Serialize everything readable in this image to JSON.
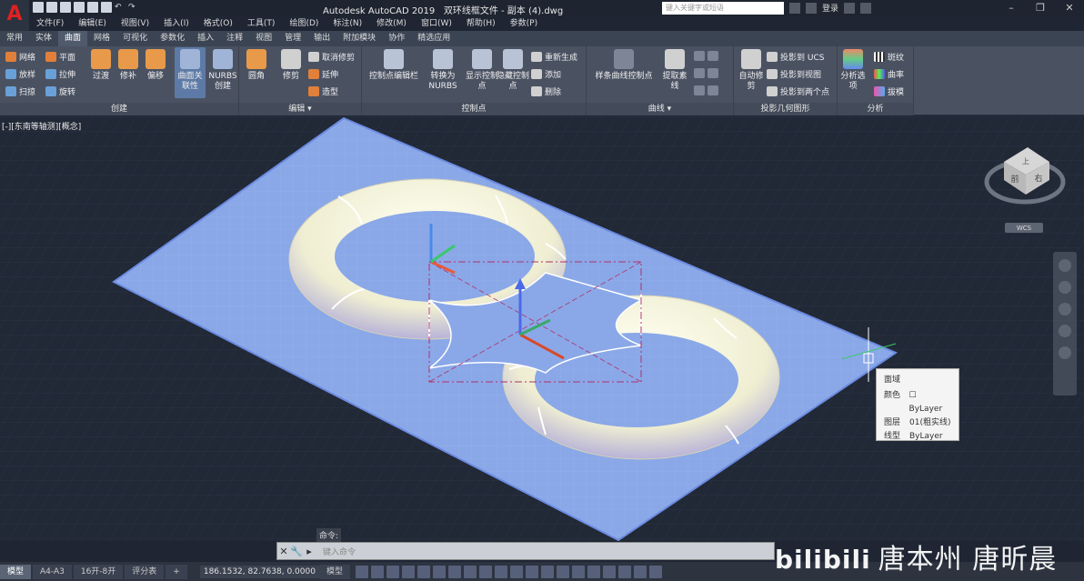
{
  "title": {
    "app": "Autodesk AutoCAD 2019",
    "file": "双环线框文件 - 副本 (4).dwg",
    "search_placeholder": "键入关键字或短语",
    "login": "登录"
  },
  "menu": [
    "文件(F)",
    "编辑(E)",
    "视图(V)",
    "插入(I)",
    "格式(O)",
    "工具(T)",
    "绘图(D)",
    "标注(N)",
    "修改(M)",
    "窗口(W)",
    "帮助(H)",
    "参数(P)"
  ],
  "tabs": [
    "常用",
    "实体",
    "曲面",
    "网格",
    "可视化",
    "参数化",
    "插入",
    "注释",
    "视图",
    "管理",
    "输出",
    "附加模块",
    "协作",
    "精选应用"
  ],
  "active_tab": "曲面",
  "ribbon": {
    "create": {
      "title": "创建",
      "small": [
        "网络",
        "放样",
        "扫掠",
        "平面",
        "拉伸",
        "旋转"
      ],
      "big": [
        "过渡",
        "修补",
        "偏移",
        "曲面关联性",
        "NURBS创建"
      ]
    },
    "edit": {
      "title": "编辑",
      "big": [
        "圆角",
        "修剪"
      ],
      "small": [
        "取消修剪",
        "延伸",
        "造型"
      ]
    },
    "cv": {
      "title": "控制点",
      "big": [
        "控制点编辑栏",
        "转换为NURBS",
        "显示控制点",
        "隐藏控制点"
      ],
      "small": [
        "重新生成",
        "添加",
        "删除"
      ]
    },
    "curves": {
      "title": "曲线",
      "big": [
        "样条曲线控制点",
        "提取素线"
      ]
    },
    "project": {
      "title": "投影几何图形",
      "big": [
        "自动修剪"
      ],
      "small": [
        "投影到 UCS",
        "投影到视图",
        "投影到两个点"
      ]
    },
    "analysis": {
      "title": "分析",
      "big": [
        "分析选项"
      ],
      "small": [
        "斑纹",
        "曲率",
        "拔模"
      ]
    }
  },
  "viewport_label": "[-][东南等轴测][概念]",
  "viewcube": {
    "top": "上",
    "front": "前",
    "right": "右",
    "wcs": "WCS"
  },
  "tooltip": {
    "heading": "面域",
    "rows": [
      {
        "k": "颜色",
        "v": "ByLayer"
      },
      {
        "k": "图层",
        "v": "01(粗实线)"
      },
      {
        "k": "线型",
        "v": "ByLayer"
      }
    ]
  },
  "command": {
    "history": "命令:",
    "placeholder": "键入命令"
  },
  "layouts": [
    "模型",
    "A4-A3",
    "16开-8开",
    "评分表"
  ],
  "coords": "186.1532, 82.7638, 0.0000",
  "model_label": "模型",
  "watermark": "唐本州 唐昕晨",
  "colors": {
    "plane": "#8aa8e8",
    "torus": "#f3f1d8",
    "ribbon": "#4a5262",
    "viewport": "#212836"
  }
}
